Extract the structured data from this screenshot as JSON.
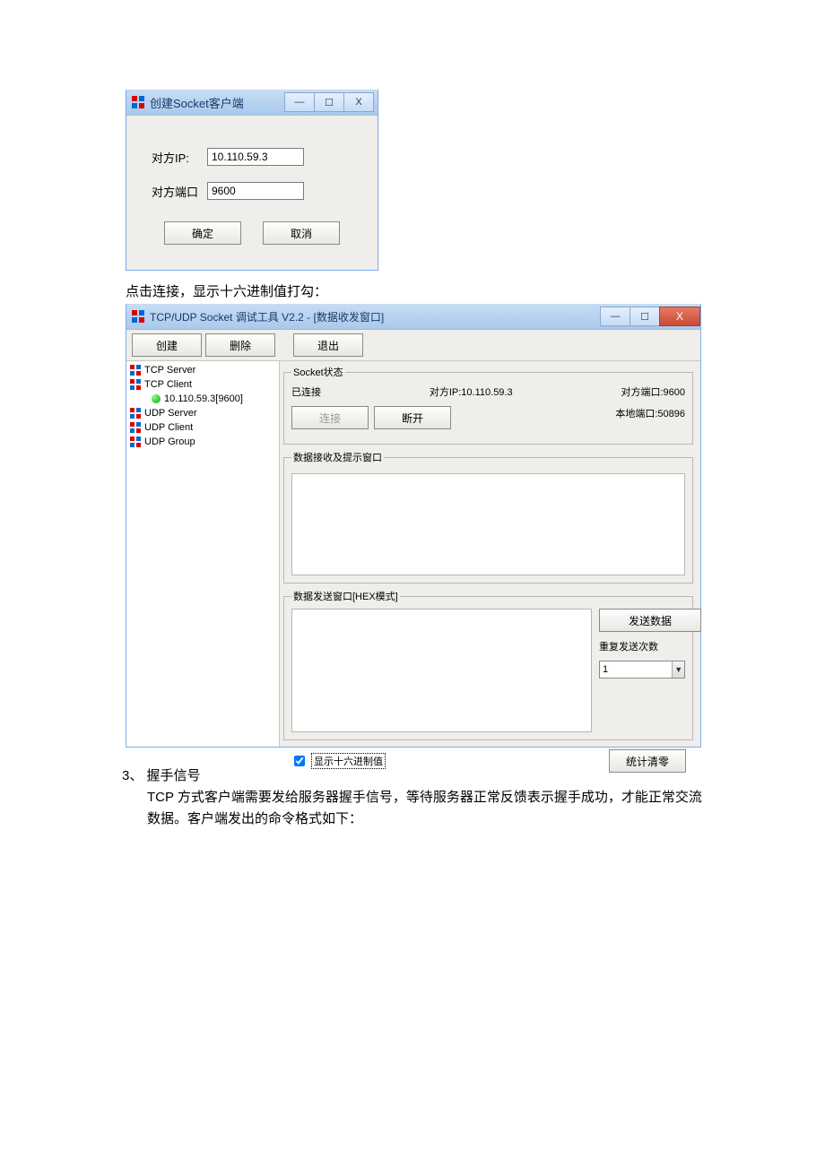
{
  "dlg1": {
    "title": "创建Socket客户端",
    "ip_label": "对方IP:",
    "ip_value": "10.110.59.3",
    "port_label": "对方端口",
    "port_value": "9600",
    "ok": "确定",
    "cancel": "取消"
  },
  "caption": "点击连接，显示十六进制值打勾：",
  "dlg2": {
    "title": "TCP/UDP Socket 调试工具 V2.2 - [数据收发窗口]",
    "toolbar": {
      "create": "创建",
      "delete": "删除",
      "exit": "退出"
    },
    "tree": {
      "n0": "TCP Server",
      "n1": "TCP Client",
      "n1a": "10.110.59.3[9600]",
      "n2": "UDP Server",
      "n3": "UDP Client",
      "n4": "UDP Group"
    },
    "status": {
      "legend": "Socket状态",
      "state": "已连接",
      "peer_ip_label": "对方IP:10.110.59.3",
      "peer_port_label": "对方端口:9600",
      "connect": "连接",
      "disconnect": "断开",
      "local_port_label": "本地端口:50896"
    },
    "rx_legend": "数据接收及提示窗口",
    "tx_legend": "数据发送窗口[HEX模式]",
    "send": "发送数据",
    "repeat_label": "重复发送次数",
    "repeat_value": "1",
    "hex_checkbox": "显示十六进制值",
    "clear_stats": "统计清零"
  },
  "sect": {
    "num": "3、",
    "title": "握手信号",
    "line1": "TCP 方式客户端需要发给服务器握手信号，等待服务器正常反馈表示握手成功，才能正常交流数据。客户端发出的命令格式如下："
  }
}
